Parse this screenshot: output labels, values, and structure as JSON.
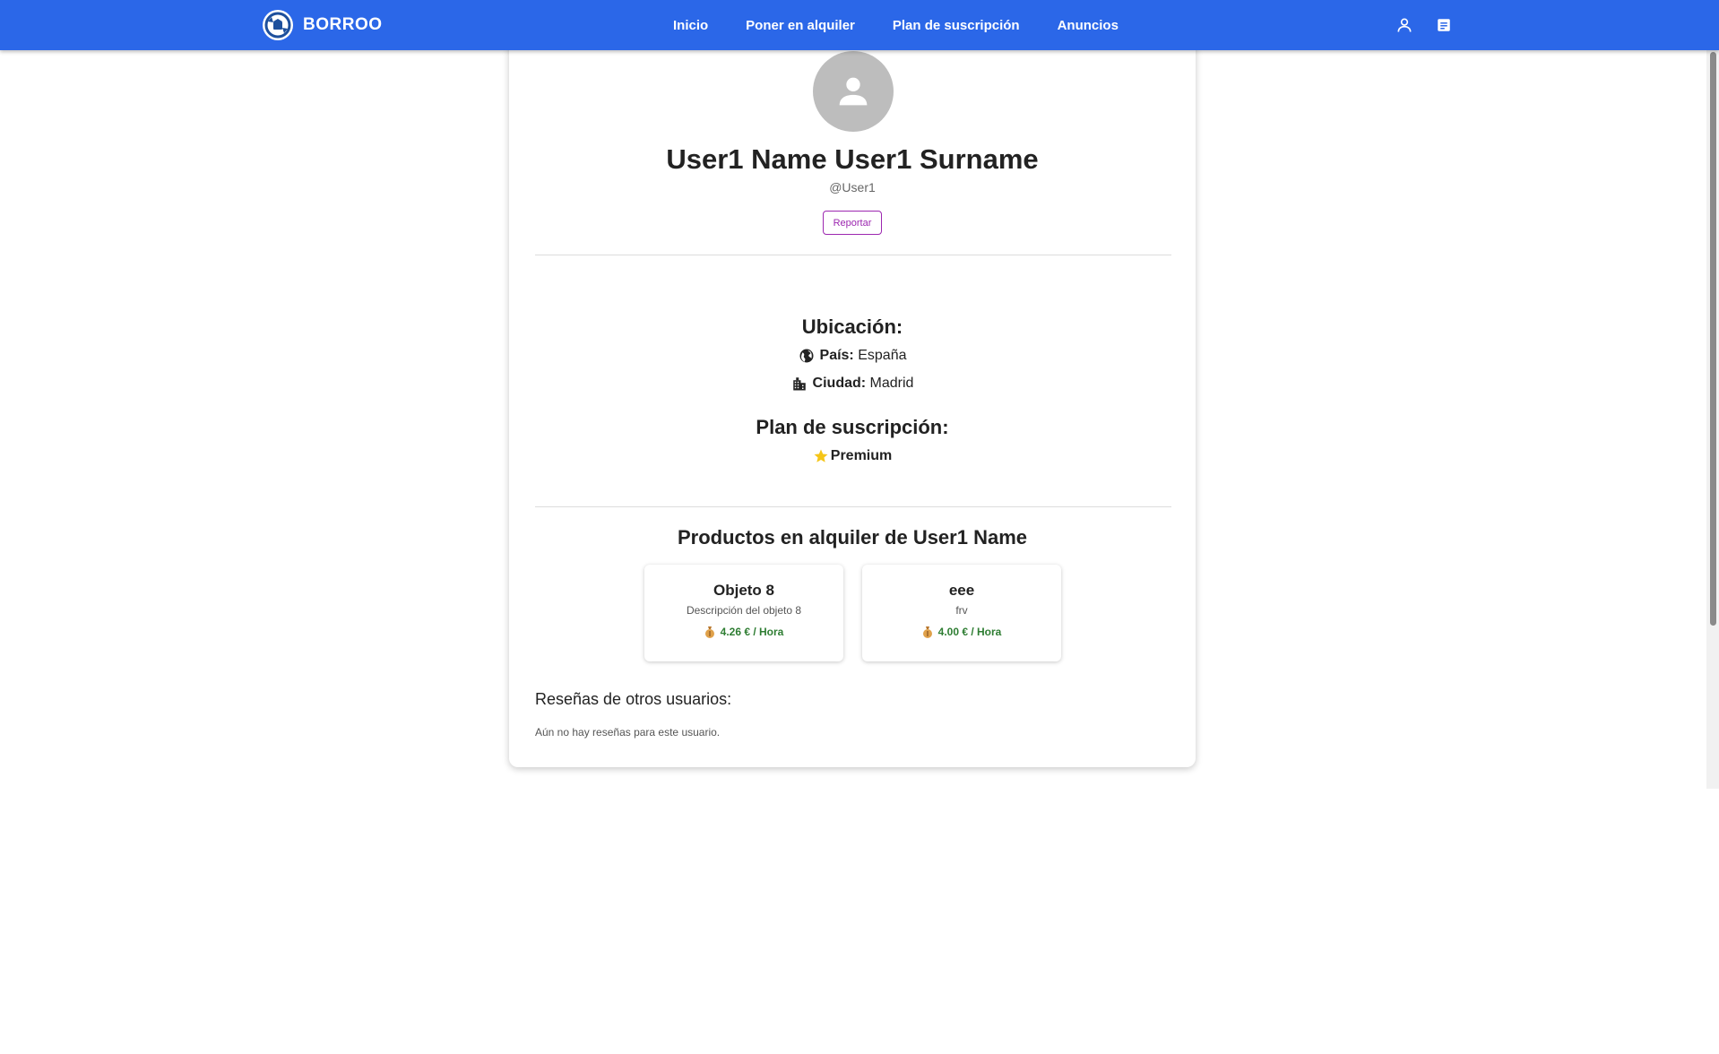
{
  "header": {
    "brand": "BORROO",
    "nav": [
      "Inicio",
      "Poner en alquiler",
      "Plan de suscripción",
      "Anuncios"
    ],
    "icons": [
      "user-icon",
      "document-icon"
    ],
    "color": "#2b67e8"
  },
  "profile": {
    "full_name": "User1 Name User1 Surname",
    "username": "@User1",
    "report_label": "Reportar"
  },
  "location": {
    "title": "Ubicación:",
    "country_label": "País:",
    "country_value": "España",
    "city_label": "Ciudad:",
    "city_value": "Madrid"
  },
  "subscription": {
    "title": "Plan de suscripción:",
    "plan": "Premium"
  },
  "products": {
    "title": "Productos en alquiler de User1 Name",
    "items": [
      {
        "name": "Objeto 8",
        "description": "Descripción del objeto 8",
        "price": "4.26 € / Hora"
      },
      {
        "name": "eee",
        "description": "frv",
        "price": "4.00 € / Hora"
      }
    ]
  },
  "reviews": {
    "title": "Reseñas de otros usuarios:",
    "empty": "Aún no hay reseñas para este usuario."
  }
}
